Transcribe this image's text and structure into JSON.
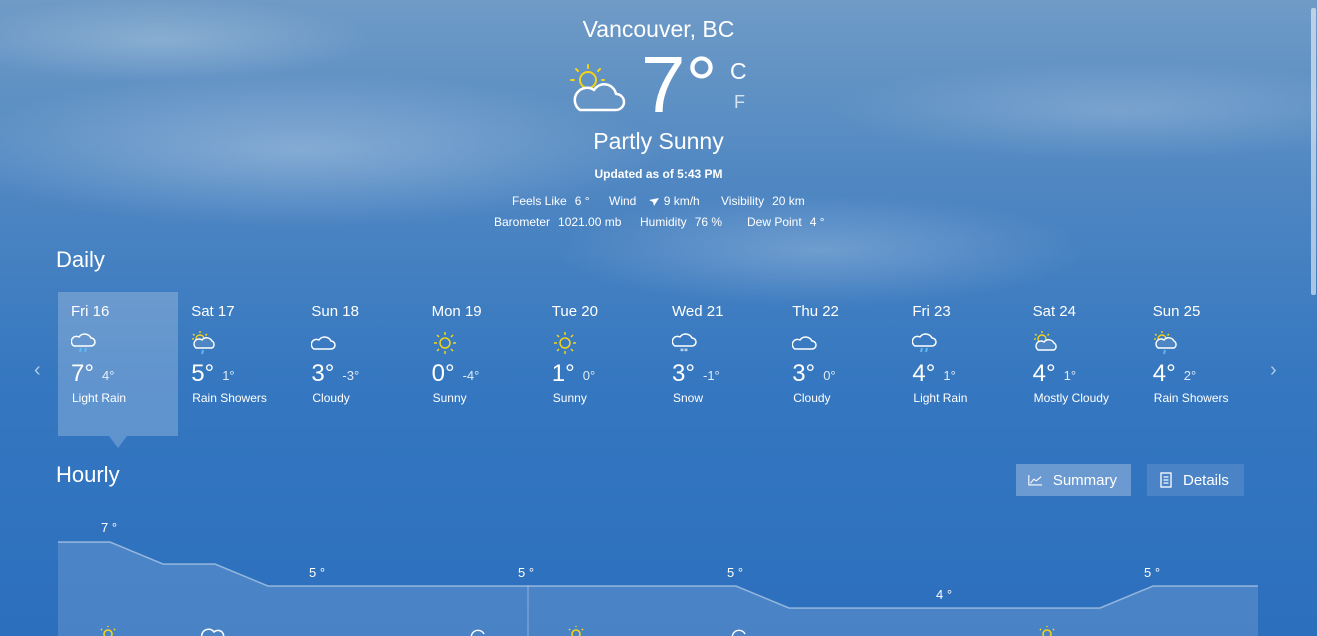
{
  "location": "Vancouver, BC",
  "current": {
    "temp": "7°",
    "unit_c": "C",
    "unit_f": "F",
    "condition": "Partly Sunny",
    "updated": "Updated as of 5:43 PM",
    "icon": "partly-sunny-icon"
  },
  "details": {
    "feels_like_label": "Feels Like",
    "feels_like": "6 °",
    "wind_label": "Wind",
    "wind": "9 km/h",
    "visibility_label": "Visibility",
    "visibility": "20 km",
    "barometer_label": "Barometer",
    "barometer": "1021.00 mb",
    "humidity_label": "Humidity",
    "humidity": "76 %",
    "dew_point_label": "Dew Point",
    "dew_point": "4 °"
  },
  "daily": {
    "title": "Daily",
    "days": [
      {
        "name": "Fri 16",
        "hi": "7°",
        "lo": "4°",
        "cond": "Light Rain",
        "icon": "rain"
      },
      {
        "name": "Sat 17",
        "hi": "5°",
        "lo": "1°",
        "cond": "Rain Showers",
        "icon": "sun-rain"
      },
      {
        "name": "Sun 18",
        "hi": "3°",
        "lo": "-3°",
        "cond": "Cloudy",
        "icon": "cloud"
      },
      {
        "name": "Mon 19",
        "hi": "0°",
        "lo": "-4°",
        "cond": "Sunny",
        "icon": "sun"
      },
      {
        "name": "Tue 20",
        "hi": "1°",
        "lo": "0°",
        "cond": "Sunny",
        "icon": "sun"
      },
      {
        "name": "Wed 21",
        "hi": "3°",
        "lo": "-1°",
        "cond": "Snow",
        "icon": "snow"
      },
      {
        "name": "Thu 22",
        "hi": "3°",
        "lo": "0°",
        "cond": "Cloudy",
        "icon": "cloud"
      },
      {
        "name": "Fri 23",
        "hi": "4°",
        "lo": "1°",
        "cond": "Light Rain",
        "icon": "rain"
      },
      {
        "name": "Sat 24",
        "hi": "4°",
        "lo": "1°",
        "cond": "Mostly Cloudy",
        "icon": "sun-cloud"
      },
      {
        "name": "Sun 25",
        "hi": "4°",
        "lo": "2°",
        "cond": "Rain Showers",
        "icon": "sun-rain"
      }
    ]
  },
  "hourly": {
    "title": "Hourly",
    "summary_label": "Summary",
    "details_label": "Details",
    "labels": [
      "7 °",
      "5 °",
      "5 °",
      "5 °",
      "4 °",
      "5 °"
    ]
  },
  "colors": {
    "sun": "#f5d416",
    "rain": "#5fb7f5"
  }
}
